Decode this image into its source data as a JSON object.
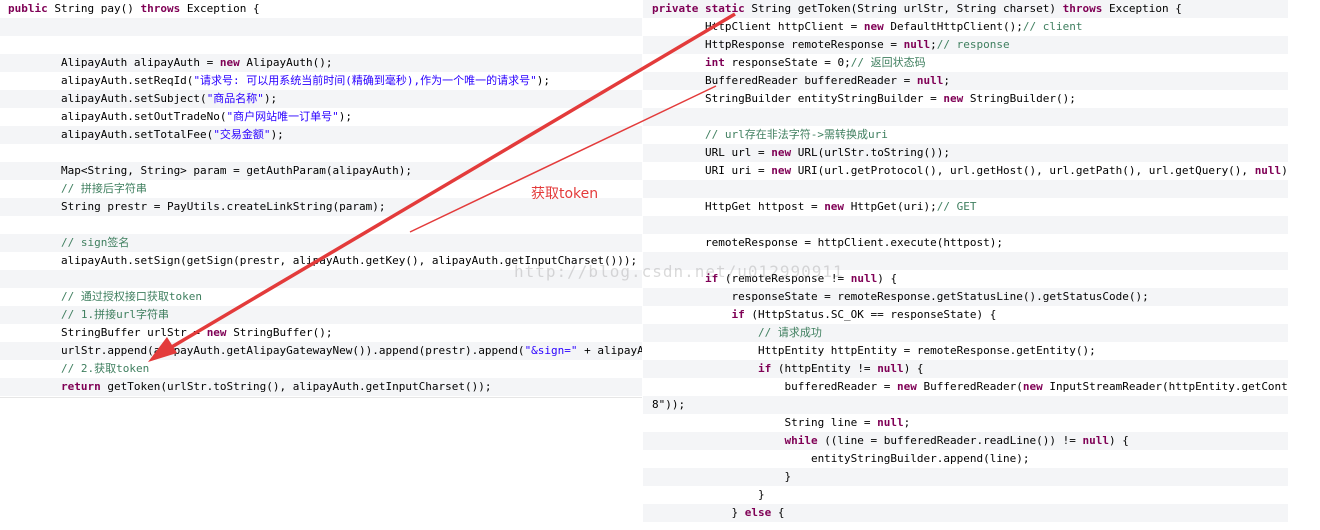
{
  "left_code": [
    [
      [
        "k",
        "public "
      ],
      [
        "n",
        "String pay() "
      ],
      [
        "k",
        "throws "
      ],
      [
        "n",
        "Exception {"
      ]
    ],
    [],
    [],
    [
      [
        "n",
        "        AlipayAuth alipayAuth = "
      ],
      [
        "k",
        "new "
      ],
      [
        "n",
        "AlipayAuth();"
      ]
    ],
    [
      [
        "n",
        "        alipayAuth.setReqId("
      ],
      [
        "s",
        "\"请求号: 可以用系统当前时间(精确到毫秒),作为一个唯一的请求号\""
      ],
      [
        "n",
        ");"
      ]
    ],
    [
      [
        "n",
        "        alipayAuth.setSubject("
      ],
      [
        "s",
        "\"商品名称\""
      ],
      [
        "n",
        ");"
      ]
    ],
    [
      [
        "n",
        "        alipayAuth.setOutTradeNo("
      ],
      [
        "s",
        "\"商户网站唯一订单号\""
      ],
      [
        "n",
        ");"
      ]
    ],
    [
      [
        "n",
        "        alipayAuth.setTotalFee("
      ],
      [
        "s",
        "\"交易金额\""
      ],
      [
        "n",
        ");"
      ]
    ],
    [],
    [
      [
        "n",
        "        Map<String, String> param = getAuthParam(alipayAuth);"
      ]
    ],
    [
      [
        "c",
        "        // 拼接后字符串"
      ]
    ],
    [
      [
        "n",
        "        String prestr = PayUtils.createLinkString(param);"
      ]
    ],
    [],
    [
      [
        "c",
        "        // sign签名"
      ]
    ],
    [
      [
        "n",
        "        alipayAuth.setSign(getSign(prestr, alipayAuth.getKey(), alipayAuth.getInputCharset()));"
      ]
    ],
    [],
    [
      [
        "c",
        "        // 通过授权接口获取token"
      ]
    ],
    [
      [
        "c",
        "        // 1.拼接url字符串"
      ]
    ],
    [
      [
        "n",
        "        StringBuffer urlStr = "
      ],
      [
        "k",
        "new "
      ],
      [
        "n",
        "StringBuffer();"
      ]
    ],
    [
      [
        "n",
        "        urlStr.append(alipayAuth.getAlipayGatewayNew()).append(prestr).append("
      ],
      [
        "s",
        "\"&sign=\""
      ],
      [
        "n",
        " + alipayA"
      ]
    ],
    [
      [
        "c",
        "        // 2.获取token"
      ]
    ],
    [
      [
        "k",
        "        return "
      ],
      [
        "n",
        "getToken(urlStr.toString(), alipayAuth.getInputCharset());"
      ]
    ],
    [
      [
        "n",
        "    }"
      ]
    ]
  ],
  "right_code": [
    [
      [
        "k",
        "private static "
      ],
      [
        "n",
        "String getToken(String urlStr, String charset) "
      ],
      [
        "k",
        "throws "
      ],
      [
        "n",
        "Exception {"
      ]
    ],
    [
      [
        "n",
        "        HttpClient httpClient = "
      ],
      [
        "k",
        "new "
      ],
      [
        "n",
        "DefaultHttpClient();"
      ],
      [
        "c",
        "// client"
      ]
    ],
    [
      [
        "n",
        "        HttpResponse remoteResponse = "
      ],
      [
        "k",
        "null"
      ],
      [
        "n",
        ";"
      ],
      [
        "c",
        "// response"
      ]
    ],
    [
      [
        "k",
        "        int "
      ],
      [
        "n",
        "responseState = 0;"
      ],
      [
        "c",
        "// 返回状态码"
      ]
    ],
    [
      [
        "n",
        "        BufferedReader bufferedReader = "
      ],
      [
        "k",
        "null"
      ],
      [
        "n",
        ";"
      ]
    ],
    [
      [
        "n",
        "        StringBuilder entityStringBuilder = "
      ],
      [
        "k",
        "new "
      ],
      [
        "n",
        "StringBuilder();"
      ]
    ],
    [],
    [
      [
        "c",
        "        // url存在非法字符->需转换成uri"
      ]
    ],
    [
      [
        "n",
        "        URL url = "
      ],
      [
        "k",
        "new "
      ],
      [
        "n",
        "URL(urlStr.toString());"
      ]
    ],
    [
      [
        "n",
        "        URI uri = "
      ],
      [
        "k",
        "new "
      ],
      [
        "n",
        "URI(url.getProtocol(), url.getHost(), url.getPath(), url.getQuery(), "
      ],
      [
        "k",
        "null"
      ],
      [
        "n",
        ");"
      ]
    ],
    [],
    [
      [
        "n",
        "        HttpGet httpost = "
      ],
      [
        "k",
        "new "
      ],
      [
        "n",
        "HttpGet(uri);"
      ],
      [
        "c",
        "// GET"
      ]
    ],
    [],
    [
      [
        "n",
        "        remoteResponse = httpClient.execute(httpost);"
      ]
    ],
    [],
    [
      [
        "k",
        "        if "
      ],
      [
        "n",
        "(remoteResponse != "
      ],
      [
        "k",
        "null"
      ],
      [
        "n",
        ") {"
      ]
    ],
    [
      [
        "n",
        "            responseState = remoteResponse.getStatusLine().getStatusCode();"
      ]
    ],
    [
      [
        "k",
        "            if "
      ],
      [
        "n",
        "(HttpStatus.SC_OK == responseState) {"
      ]
    ],
    [
      [
        "c",
        "                // 请求成功"
      ]
    ],
    [
      [
        "n",
        "                HttpEntity httpEntity = remoteResponse.getEntity();"
      ]
    ],
    [
      [
        "k",
        "                if "
      ],
      [
        "n",
        "(httpEntity != "
      ],
      [
        "k",
        "null"
      ],
      [
        "n",
        ") {"
      ]
    ],
    [
      [
        "n",
        "                    bufferedReader = "
      ],
      [
        "k",
        "new "
      ],
      [
        "n",
        "BufferedReader("
      ],
      [
        "k",
        "new "
      ],
      [
        "n",
        "InputStreamReader(httpEntity.getConte"
      ]
    ],
    [
      [
        "n",
        "8\"));"
      ]
    ],
    [
      [
        "n",
        "                    String line = "
      ],
      [
        "k",
        "null"
      ],
      [
        "n",
        ";"
      ]
    ],
    [
      [
        "k",
        "                    while "
      ],
      [
        "n",
        "((line = bufferedReader.readLine()) != "
      ],
      [
        "k",
        "null"
      ],
      [
        "n",
        ") {"
      ]
    ],
    [
      [
        "n",
        "                        entityStringBuilder.append(line);"
      ]
    ],
    [
      [
        "n",
        "                    }"
      ]
    ],
    [
      [
        "n",
        "                }"
      ]
    ],
    [
      [
        "n",
        "            } "
      ],
      [
        "k",
        "else "
      ],
      [
        "n",
        "{"
      ]
    ]
  ],
  "annotation": {
    "label": "获取token",
    "color": "#e33b3b"
  },
  "watermark": {
    "text": "http://blog.csdn.net/u012990911"
  },
  "colors": {
    "keyword": "#7f0055",
    "string": "#2a00ff",
    "comment": "#3f7f5f",
    "arrow": "#e33b3b"
  }
}
